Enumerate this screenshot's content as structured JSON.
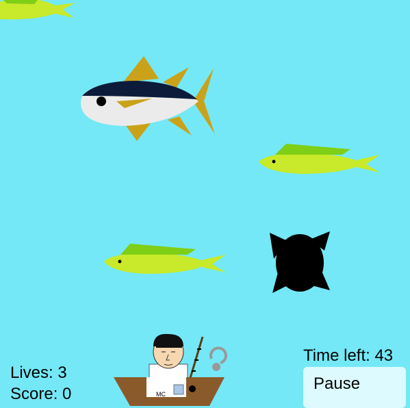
{
  "colors": {
    "water": "#74e8f6",
    "tuna_back": "#0c1b3a",
    "tuna_belly": "#ebebeb",
    "tuna_fins": "#c9a21a",
    "mahi_body": "#c8ea2a",
    "mahi_fin": "#7fcf16",
    "mine": "#000000",
    "boat": "#8b5a2b",
    "pause_button": "#dcfaff"
  },
  "hud": {
    "lives_label": "Lives: 3",
    "score_label": "Score: 0",
    "time_label": "Time left: 43",
    "pause_label": "Pause"
  },
  "fisherman": {
    "shirt_text": "MC"
  },
  "sprites": [
    "tuna",
    "mahi-mahi",
    "mahi-mahi",
    "mahi-mahi",
    "spiked-mine",
    "fisherman-boat",
    "fishing-hook"
  ]
}
